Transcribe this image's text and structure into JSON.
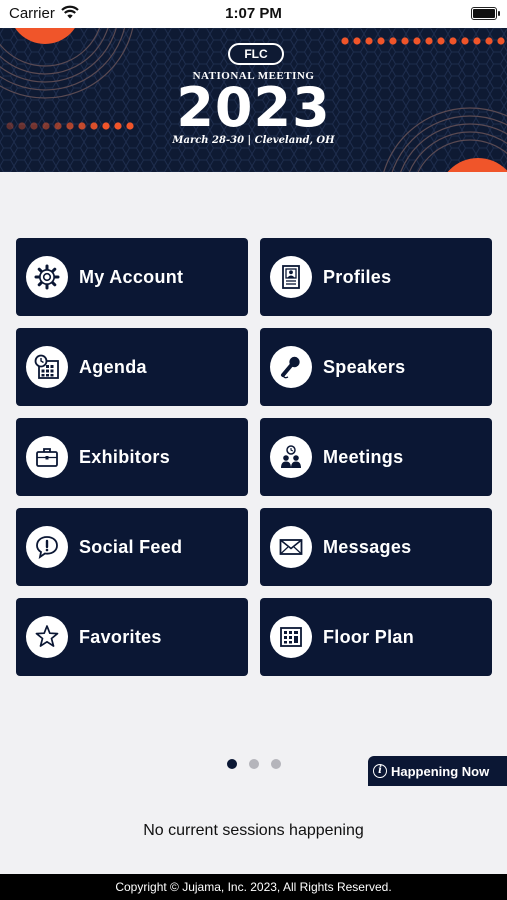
{
  "status_bar": {
    "carrier": "Carrier",
    "time": "1:07 PM"
  },
  "banner": {
    "logo": "FLC",
    "subtitle": "NATIONAL MEETING",
    "year": "2023",
    "dates": "March 28-30 | Cleveland, OH",
    "colors": {
      "background": "#0e1a33",
      "accent": "#f0552a"
    }
  },
  "menu": [
    {
      "label": "My Account",
      "icon": "gear-icon"
    },
    {
      "label": "Profiles",
      "icon": "profile-card-icon"
    },
    {
      "label": "Agenda",
      "icon": "calendar-clock-icon"
    },
    {
      "label": "Speakers",
      "icon": "microphone-icon"
    },
    {
      "label": "Exhibitors",
      "icon": "briefcase-icon"
    },
    {
      "label": "Meetings",
      "icon": "people-meeting-icon"
    },
    {
      "label": "Social Feed",
      "icon": "speech-bubble-alert-icon"
    },
    {
      "label": "Messages",
      "icon": "envelope-icon"
    },
    {
      "label": "Favorites",
      "icon": "star-icon"
    },
    {
      "label": "Floor Plan",
      "icon": "floor-plan-icon"
    }
  ],
  "pager": {
    "total": 3,
    "active": 1
  },
  "happening_now": {
    "label": "Happening Now",
    "empty_message": "No current sessions happening"
  },
  "footer": {
    "copyright": "Copyright © Jujama, Inc. 2023, All Rights Reserved."
  },
  "colors": {
    "tile": "#0b1734",
    "page_bg": "#f1f1f3",
    "dot_active": "#0b1734",
    "dot_inactive": "#b5b5bb"
  }
}
